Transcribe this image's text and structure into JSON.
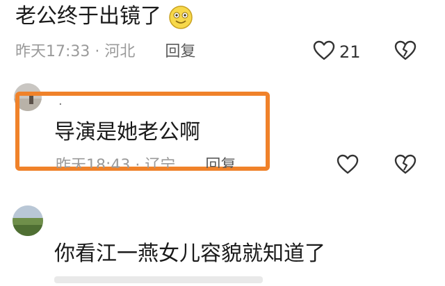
{
  "comments": [
    {
      "text": "老公终于出镜了",
      "emoji": "smiling-face-emoji",
      "time": "昨天17:33",
      "location": "河北",
      "reply_label": "回复",
      "like_count": "21"
    },
    {
      "username": "·",
      "text": "导演是她老公啊",
      "time": "昨天18:43",
      "location": "辽宁",
      "reply_label": "回复"
    },
    {
      "text": "你看江一燕女儿容貌就知道了"
    }
  ],
  "colors": {
    "highlight": "#f0822a",
    "meta_text": "#9a9a9a",
    "text": "#1a1a1a"
  },
  "icons": [
    "heart-outline-icon",
    "broken-heart-icon",
    "smiling-face-emoji"
  ]
}
